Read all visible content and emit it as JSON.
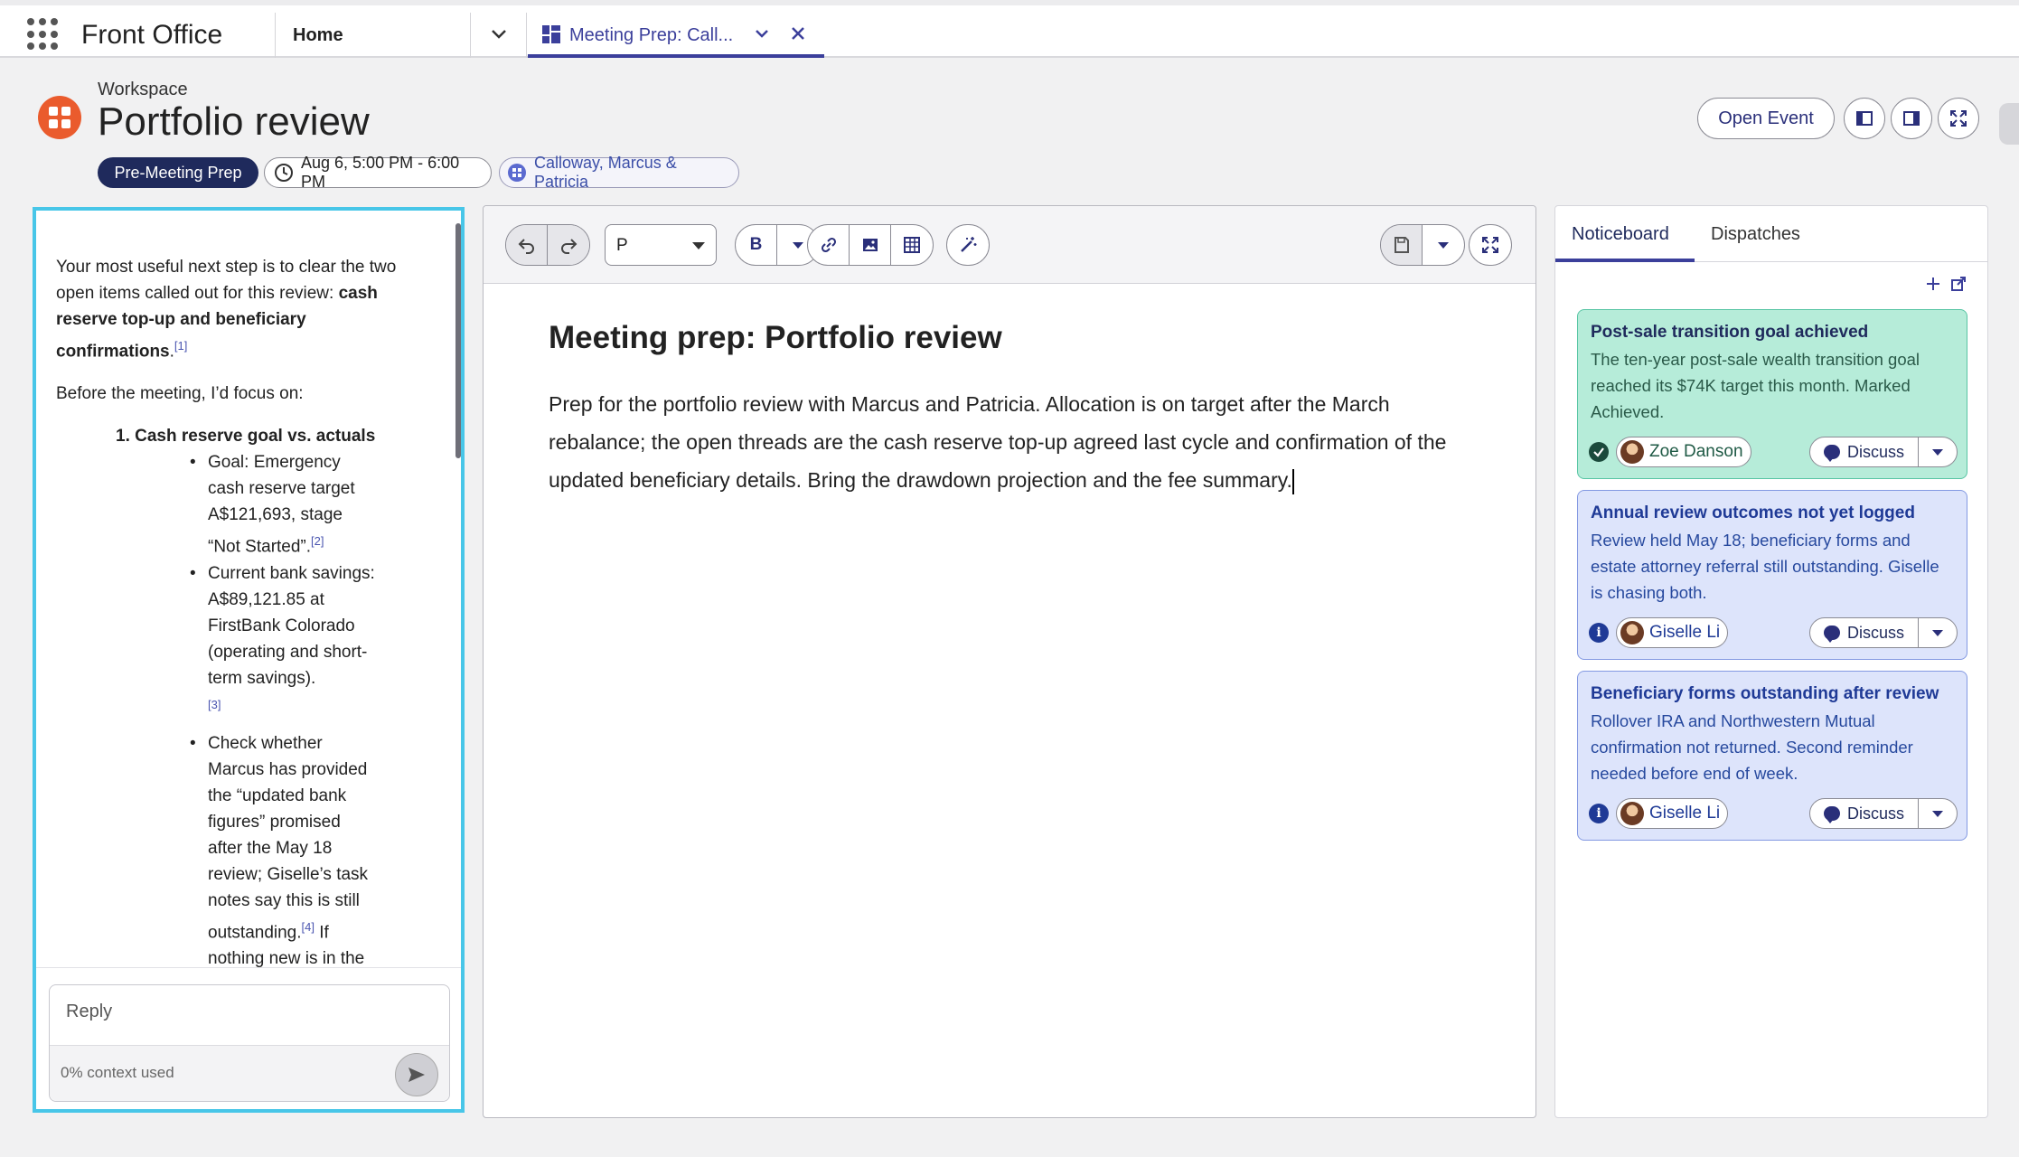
{
  "nav": {
    "app_name": "Front Office",
    "home_tab": "Home",
    "active_tab": "Meeting Prep: Call..."
  },
  "header": {
    "workspace_label": "Workspace",
    "title": "Portfolio review",
    "stage_pill": "Pre-Meeting Prep",
    "time_pill": "Aug 6, 5:00 PM - 6:00 PM",
    "people_pill": "Calloway, Marcus & Patricia",
    "open_event": "Open Event"
  },
  "chat": {
    "intro_1": "Your most useful next step is to clear the two open items called out for this review: ",
    "intro_bold": "cash reserve top-up and beneficiary confirmations",
    "intro_period": ".",
    "cite_1": "[1]",
    "focus_line": "Before the meeting, I’d focus on:",
    "item_1_title": "1. Cash reserve goal vs. actuals",
    "bullet_1": "Goal: Emergency cash reserve target A$121,693, stage “Not Started”.",
    "cite_2": "[2]",
    "bullet_2": "Current bank savings: A$89,121.85 at FirstBank Colorado (operating and short-term savings).",
    "cite_3": "[3]",
    "bullet_3a": "Check whether Marcus has provided the “updated bank figures” promised after the May 18 review; Giselle’s task notes say this is still outstanding.",
    "cite_4": "[4]",
    "bullet_3b": " If nothing new is in the",
    "reply_placeholder": "Reply",
    "context_used": "0% context used"
  },
  "editor": {
    "format_value": "P",
    "bold_label": "B",
    "doc_title": "Meeting prep: Portfolio review",
    "doc_body": "Prep for the portfolio review with Marcus and Patricia. Allocation is on target after the March rebalance; the open threads are the cash reserve top-up agreed last cycle and confirmation of the updated beneficiary details. Bring the drawdown projection and the fee summary."
  },
  "side": {
    "tabs": [
      "Noticeboard",
      "Dispatches"
    ],
    "discuss_label": "Discuss",
    "cards": [
      {
        "title": "Post-sale transition goal achieved",
        "body": "The ten-year post-sale wealth transition goal reached its $74K target this month. Marked Achieved.",
        "person": "Zoe Danson",
        "status": "check-icon",
        "tone": "green"
      },
      {
        "title": "Annual review outcomes not yet logged",
        "body": "Review held May 18; beneficiary forms and estate attorney referral still outstanding. Giselle is chasing both.",
        "person": "Giselle Li",
        "status": "info-icon",
        "tone": "blue"
      },
      {
        "title": "Beneficiary forms outstanding after review",
        "body": "Rollover IRA and Northwestern Mutual confirmation not returned. Second reminder needed before end of week.",
        "person": "Giselle Li",
        "status": "info-icon",
        "tone": "blue"
      }
    ]
  },
  "colors": {
    "accent": "#3b3f9b",
    "chat_border": "#48c6e8",
    "workspace_icon": "#ea5b2d",
    "green_card": "#b6ecd9",
    "blue_card": "#dde4fb"
  }
}
